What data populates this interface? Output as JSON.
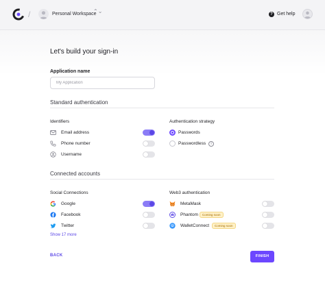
{
  "header": {
    "workspace_name": "Personal Workspace",
    "help_label": "Get help",
    "separator": "/",
    "switch_glyph": "⌃⌄"
  },
  "page": {
    "title": "Let's build your sign-in"
  },
  "application": {
    "label": "Application name",
    "placeholder": "My Application",
    "value": ""
  },
  "standard_auth": {
    "title": "Standard authentication",
    "identifiers": {
      "label": "Identifiers",
      "items": [
        {
          "label": "Email address",
          "icon": "mail-icon",
          "enabled": true
        },
        {
          "label": "Phone number",
          "icon": "phone-icon",
          "enabled": false
        },
        {
          "label": "Username",
          "icon": "user-circle-icon",
          "enabled": false
        }
      ]
    },
    "strategy": {
      "label": "Authentication strategy",
      "options": [
        {
          "label": "Passwords",
          "selected": true
        },
        {
          "label": "Passwordless",
          "selected": false,
          "info": true
        }
      ]
    }
  },
  "connected": {
    "title": "Connected accounts",
    "social": {
      "label": "Social Connections",
      "items": [
        {
          "label": "Google",
          "icon": "google-icon",
          "enabled": true
        },
        {
          "label": "Facebook",
          "icon": "facebook-icon",
          "enabled": false
        },
        {
          "label": "Twitter",
          "icon": "twitter-icon",
          "enabled": false
        }
      ],
      "show_more": "Show 17 more"
    },
    "web3": {
      "label": "Web3 authentication",
      "items": [
        {
          "label": "MetaMask",
          "icon": "metamask-icon",
          "enabled": false,
          "badge": ""
        },
        {
          "label": "Phantom",
          "icon": "phantom-icon",
          "enabled": false,
          "badge": "Coming soon"
        },
        {
          "label": "WalletConnect",
          "icon": "walletconnect-icon",
          "enabled": false,
          "badge": "Coming soon"
        }
      ]
    }
  },
  "footer": {
    "back_label": "BACK",
    "finish_label": "FINISH"
  },
  "colors": {
    "accent": "#6c47ff",
    "toggle_on": "#8b7cf6",
    "badge_bg": "#fff1c7",
    "badge_text": "#a26a00"
  }
}
